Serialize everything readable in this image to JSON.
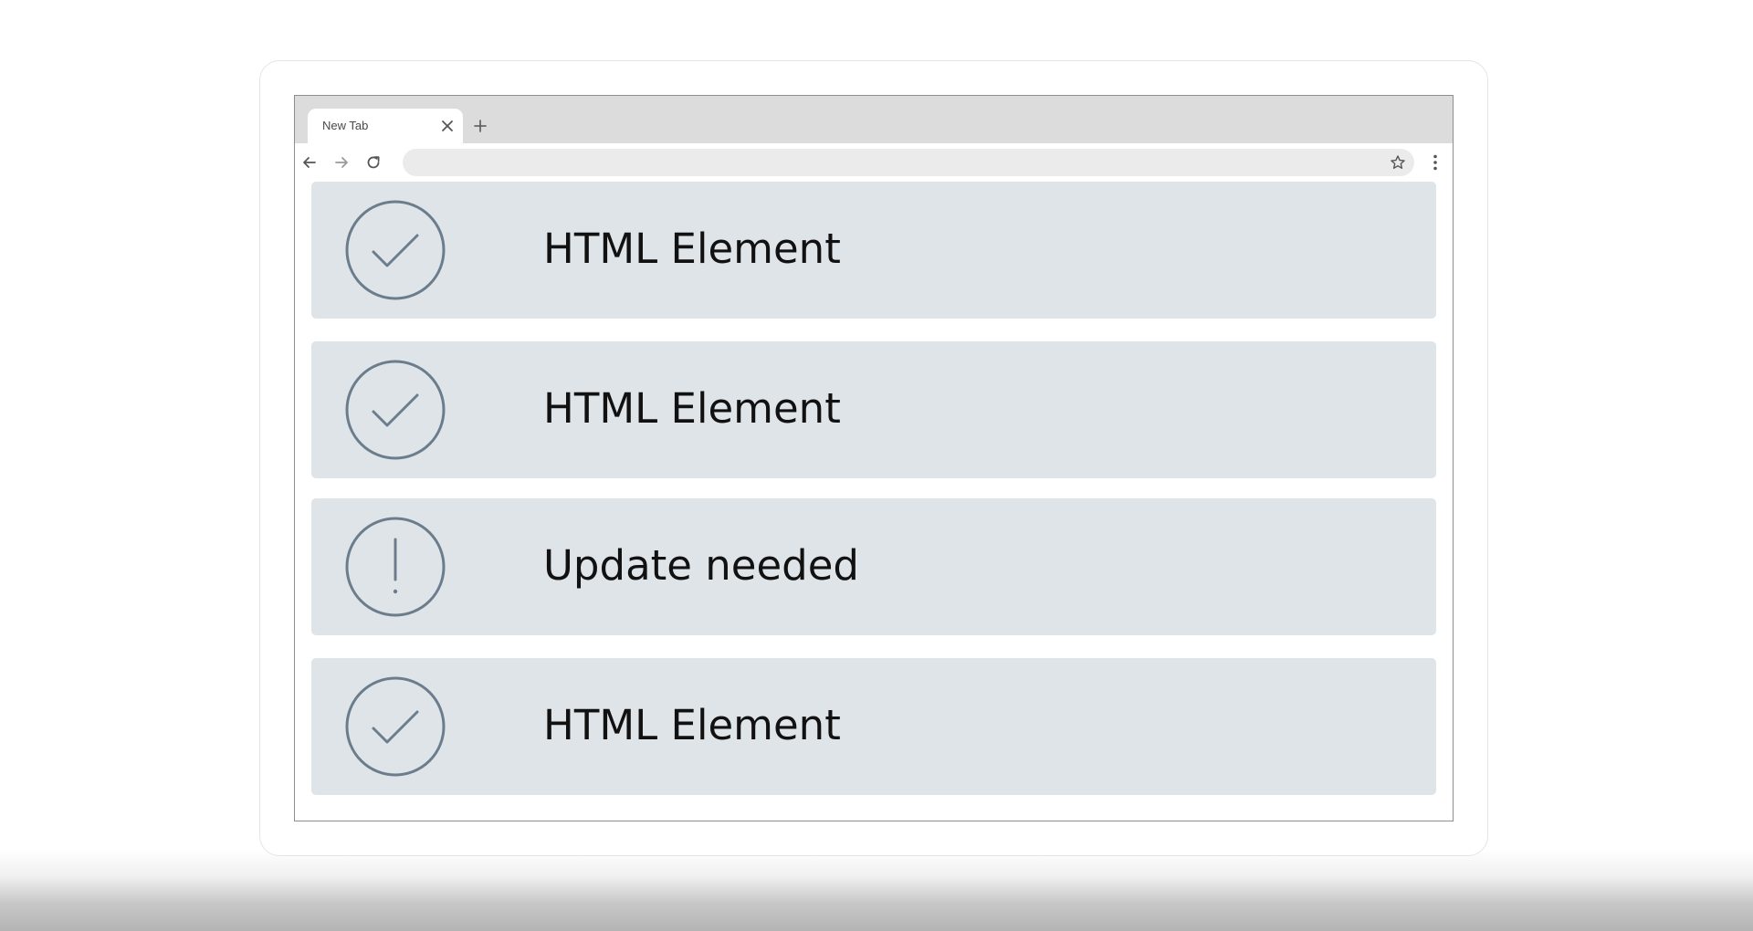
{
  "browser": {
    "tab": {
      "title": "New Tab"
    },
    "address_bar": {
      "value": "",
      "placeholder": ""
    }
  },
  "items": [
    {
      "label": "HTML Element",
      "status": "ok",
      "icon": "check-circle-icon"
    },
    {
      "label": "HTML Element",
      "status": "ok",
      "icon": "check-circle-icon"
    },
    {
      "label": "Update needed",
      "status": "warning",
      "icon": "exclamation-circle-icon"
    },
    {
      "label": "HTML Element",
      "status": "ok",
      "icon": "check-circle-icon"
    }
  ],
  "colors": {
    "row_background": "#dfe4e8",
    "icon_stroke": "#6b7d8c",
    "tabbar_background": "#dcdcdc"
  }
}
